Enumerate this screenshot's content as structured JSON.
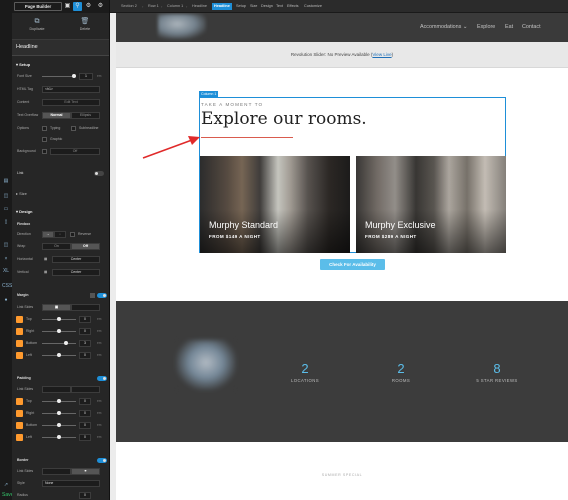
{
  "colors": {
    "accent": "#1e8fd8",
    "cta": "#5bbde9",
    "arrow": "#e02a2a",
    "panel": "#262626",
    "site_dark": "#3c3c3c"
  },
  "builder": {
    "title": "Page Builder",
    "toolbar_icons": [
      "page-icon",
      "search-icon",
      "gear-icon",
      "cog-icon"
    ],
    "tabs": [
      {
        "label": "Duplicate",
        "icon": "duplicate-icon"
      },
      {
        "label": "Delete",
        "icon": "trash-icon"
      }
    ],
    "element_title": "Headline",
    "setup": {
      "section": "Setup",
      "font_size": {
        "label": "Font Size",
        "value": "1",
        "unit": "em"
      },
      "html_tag": {
        "label": "HTML Tag",
        "value": "<h1>"
      },
      "content": {
        "label": "Content",
        "value": "Edit Text"
      },
      "text_overflow": {
        "label": "Text Overflow",
        "options": [
          "Normal",
          "Ellipsis"
        ],
        "selected": "Normal"
      },
      "options": {
        "label": "Options",
        "checks": [
          "Typing",
          "Subheadline",
          "Graphic"
        ]
      },
      "background": {
        "label": "Background",
        "value": "Off"
      },
      "link": {
        "label": "Link"
      },
      "size": {
        "label": "Size"
      }
    },
    "design": {
      "section": "Design",
      "flexbox": {
        "label": "Flexbox",
        "direction": {
          "label": "Direction",
          "options": [
            "→",
            "↓"
          ],
          "extra": "Reverse"
        },
        "wrap": {
          "label": "Wrap",
          "options": [
            "On",
            "Off"
          ],
          "selected": "Off"
        },
        "horizontal": {
          "label": "Horizontal",
          "value": "Center"
        },
        "vertical": {
          "label": "Vertical",
          "value": "Center"
        }
      },
      "margin": {
        "label": "Margin",
        "link": "Link Sides",
        "sides": [
          {
            "label": "Top",
            "value": "0"
          },
          {
            "label": "Right",
            "value": "0"
          },
          {
            "label": "Bottom",
            "value": "3"
          },
          {
            "label": "Left",
            "value": "0"
          }
        ],
        "unit": "em"
      },
      "padding": {
        "label": "Padding",
        "link": "Link Sides",
        "sides": [
          {
            "label": "Top",
            "value": "0"
          },
          {
            "label": "Right",
            "value": "0"
          },
          {
            "label": "Bottom",
            "value": "0"
          },
          {
            "label": "Left",
            "value": "0"
          }
        ],
        "unit": "em"
      },
      "border": {
        "label": "Border",
        "link": "Link Sides",
        "style": {
          "label": "Style",
          "value": "None"
        },
        "radius": {
          "label": "Radius",
          "value": "0"
        }
      }
    },
    "rail_icons": [
      "screen-icon",
      "desktop-icon",
      "tablet-icon",
      "phone-icon",
      "x-icon",
      "xl-icon",
      "css-icon",
      "globe-icon",
      "save-icon"
    ],
    "rail_labels": {
      "xl": "XL",
      "css": "CSS",
      "save": "Save"
    }
  },
  "breadcrumbs": [
    "Section 2",
    "Row 1",
    "Column 1",
    "Headline"
  ],
  "editor_tabs": [
    {
      "label": "Headline",
      "active": true
    },
    {
      "label": "Setup"
    },
    {
      "label": "Size"
    },
    {
      "label": "Design"
    },
    {
      "label": "Text"
    },
    {
      "label": "Effects"
    },
    {
      "label": "Customize"
    }
  ],
  "site": {
    "nav": [
      "Accommodations",
      "Explore",
      "Eat",
      "Contact"
    ],
    "slider_notice": "Revolution Slider: No Preview Available",
    "slider_link": "View Live",
    "column_tag": "Column 1",
    "kicker": "TAKE A MOMENT TO",
    "headline": "Explore our rooms.",
    "rooms": [
      {
        "name": "Murphy Standard",
        "price": "FROM $149 A NIGHT"
      },
      {
        "name": "Murphy Exclusive",
        "price": "FROM $289 A NIGHT"
      }
    ],
    "cta": "Check For Availability",
    "stats": [
      {
        "value": "2",
        "label": "LOCATIONS"
      },
      {
        "value": "2",
        "label": "ROOMS"
      },
      {
        "value": "8",
        "label": "5 STAR REVIEWS"
      }
    ],
    "footer": "SUMMER SPECIAL"
  }
}
